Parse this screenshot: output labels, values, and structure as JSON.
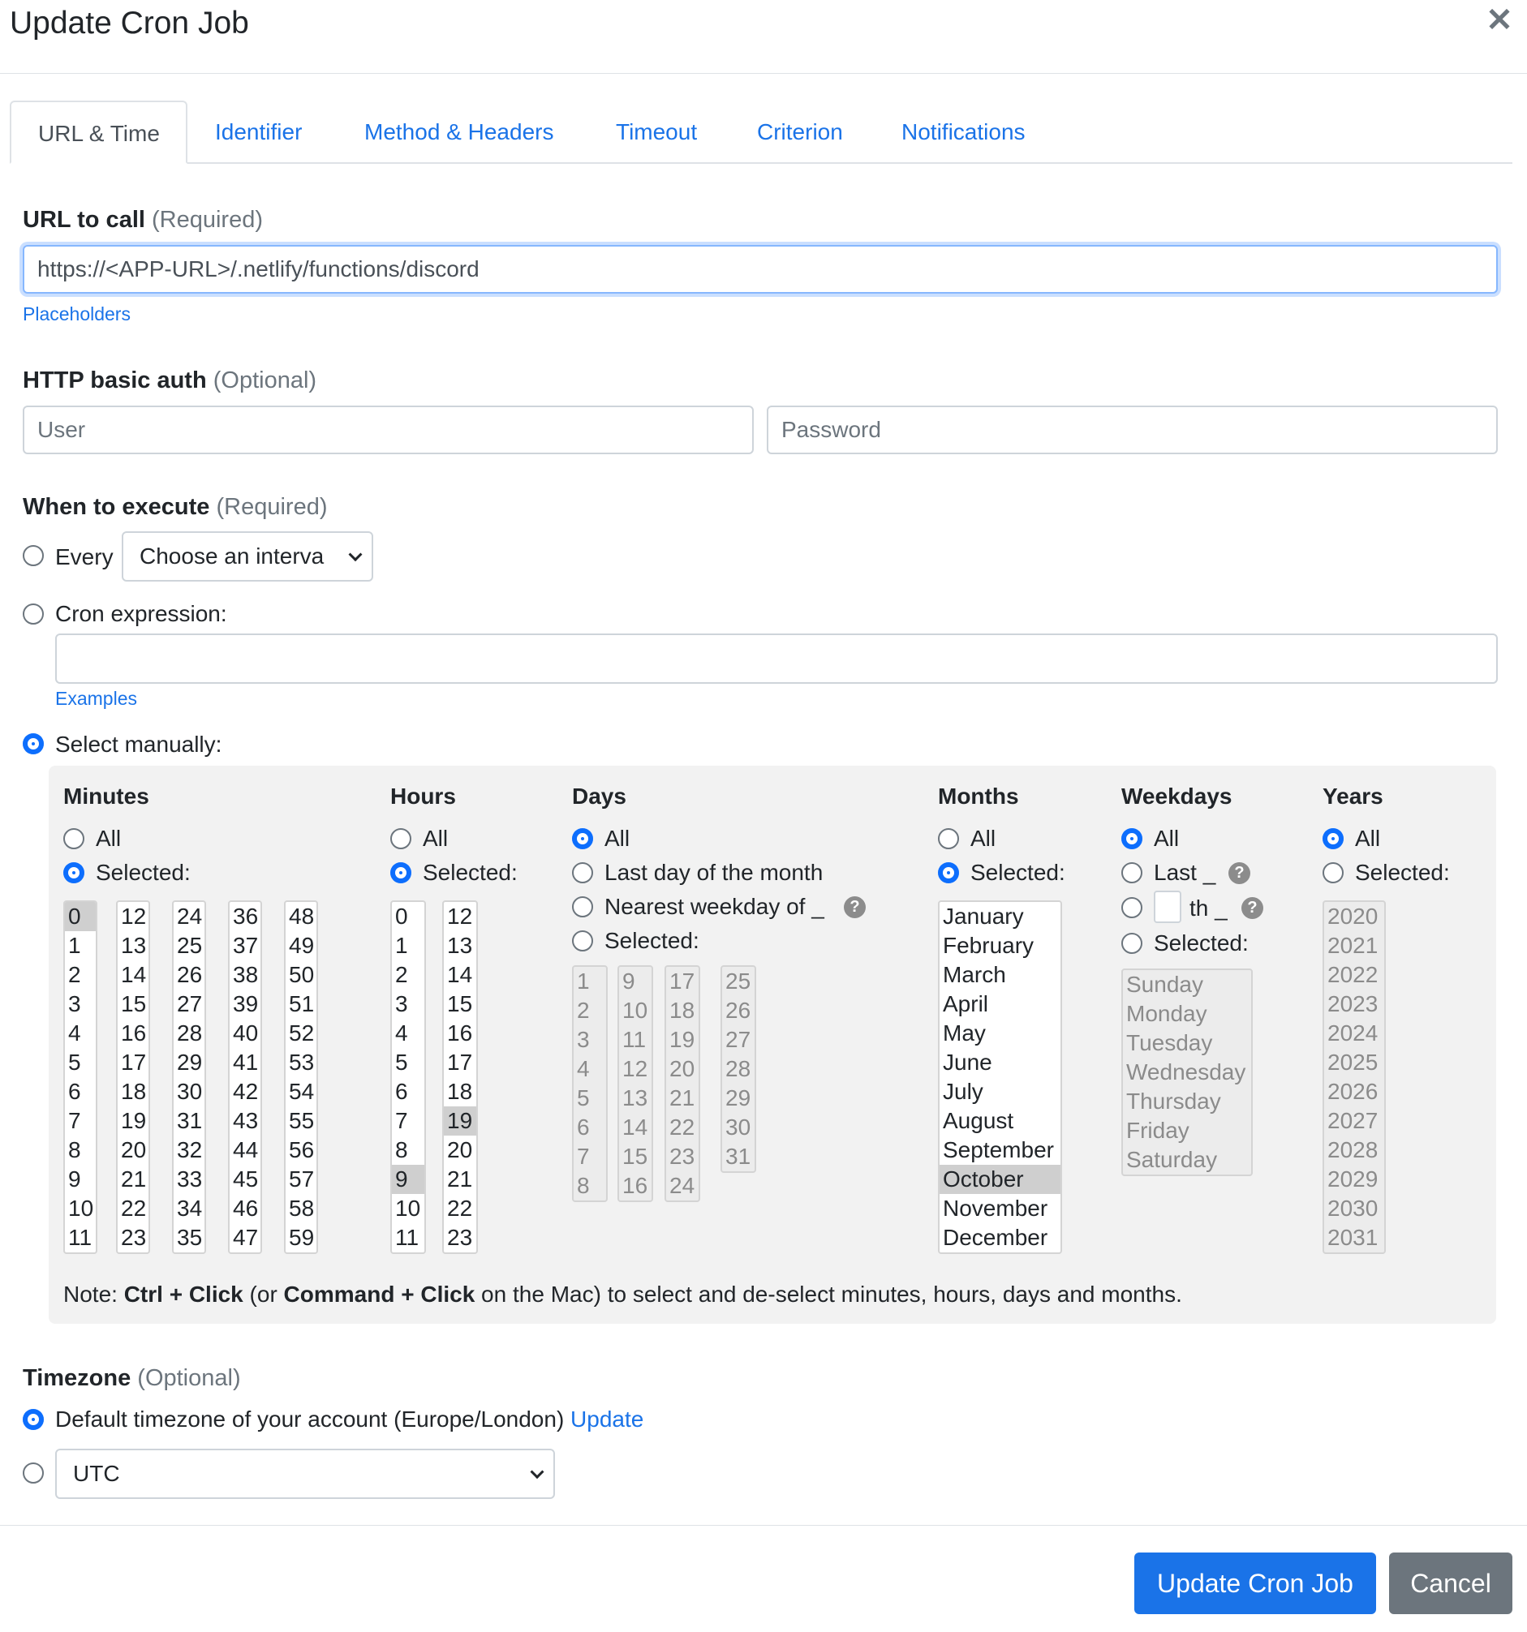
{
  "dialog": {
    "title": "Update Cron Job",
    "close_icon": "close-icon"
  },
  "tabs": [
    {
      "label": "URL & Time",
      "active": true
    },
    {
      "label": "Identifier"
    },
    {
      "label": "Method & Headers"
    },
    {
      "label": "Timeout"
    },
    {
      "label": "Criterion"
    },
    {
      "label": "Notifications"
    }
  ],
  "url": {
    "label": "URL to call",
    "hint": "(Required)",
    "value": "https://<APP-URL>/.netlify/functions/discord",
    "placeholders_link": "Placeholders"
  },
  "auth": {
    "label": "HTTP basic auth",
    "hint": "(Optional)",
    "user_placeholder": "User",
    "password_placeholder": "Password"
  },
  "when": {
    "label": "When to execute",
    "hint": "(Required)",
    "every_label": "Every",
    "interval_value": "Choose an interva",
    "cron_label": "Cron expression:",
    "examples_link": "Examples",
    "manual_label": "Select manually:",
    "selected_mode": "manual"
  },
  "schedule": {
    "minutes": {
      "title": "Minutes",
      "all": "All",
      "selected": "Selected:",
      "mode": "selected",
      "columns": [
        [
          "0",
          "1",
          "2",
          "3",
          "4",
          "5",
          "6",
          "7",
          "8",
          "9",
          "10",
          "11"
        ],
        [
          "12",
          "13",
          "14",
          "15",
          "16",
          "17",
          "18",
          "19",
          "20",
          "21",
          "22",
          "23"
        ],
        [
          "24",
          "25",
          "26",
          "27",
          "28",
          "29",
          "30",
          "31",
          "32",
          "33",
          "34",
          "35"
        ],
        [
          "36",
          "37",
          "38",
          "39",
          "40",
          "41",
          "42",
          "43",
          "44",
          "45",
          "46",
          "47"
        ],
        [
          "48",
          "49",
          "50",
          "51",
          "52",
          "53",
          "54",
          "55",
          "56",
          "57",
          "58",
          "59"
        ]
      ],
      "chosen": [
        "0"
      ]
    },
    "hours": {
      "title": "Hours",
      "all": "All",
      "selected": "Selected:",
      "mode": "selected",
      "columns": [
        [
          "0",
          "1",
          "2",
          "3",
          "4",
          "5",
          "6",
          "7",
          "8",
          "9",
          "10",
          "11"
        ],
        [
          "12",
          "13",
          "14",
          "15",
          "16",
          "17",
          "18",
          "19",
          "20",
          "21",
          "22",
          "23"
        ]
      ],
      "chosen": [
        "9",
        "19"
      ]
    },
    "days": {
      "title": "Days",
      "all": "All",
      "last_day": "Last day of the month",
      "nearest": "Nearest weekday of _",
      "selected": "Selected:",
      "mode": "all",
      "columns": [
        [
          "1",
          "2",
          "3",
          "4",
          "5",
          "6",
          "7",
          "8"
        ],
        [
          "9",
          "10",
          "11",
          "12",
          "13",
          "14",
          "15",
          "16"
        ],
        [
          "17",
          "18",
          "19",
          "20",
          "21",
          "22",
          "23",
          "24"
        ],
        [
          "25",
          "26",
          "27",
          "28",
          "29",
          "30",
          "31"
        ]
      ]
    },
    "months": {
      "title": "Months",
      "all": "All",
      "selected": "Selected:",
      "mode": "selected",
      "items": [
        "January",
        "February",
        "March",
        "April",
        "May",
        "June",
        "July",
        "August",
        "September",
        "October",
        "November",
        "December"
      ],
      "chosen": [
        "October"
      ]
    },
    "weekdays": {
      "title": "Weekdays",
      "all": "All",
      "last": "Last _",
      "nth": "th _",
      "selected": "Selected:",
      "mode": "all",
      "items": [
        "Sunday",
        "Monday",
        "Tuesday",
        "Wednesday",
        "Thursday",
        "Friday",
        "Saturday"
      ]
    },
    "years": {
      "title": "Years",
      "all": "All",
      "selected": "Selected:",
      "mode": "all",
      "items": [
        "2020",
        "2021",
        "2022",
        "2023",
        "2024",
        "2025",
        "2026",
        "2027",
        "2028",
        "2029",
        "2030",
        "2031"
      ]
    },
    "note": {
      "prefix": "Note: ",
      "ctrl": "Ctrl + Click",
      "mid1": " (or ",
      "cmd": "Command + Click",
      "suffix": " on the Mac) to select and de-select minutes, hours, days and months."
    }
  },
  "timezone": {
    "label": "Timezone",
    "hint": "(Optional)",
    "default_text": "Default timezone of your account (Europe/London)",
    "update_link": "Update",
    "custom_value": "UTC",
    "mode": "default"
  },
  "footer": {
    "update_button": "Update Cron Job",
    "cancel_button": "Cancel"
  },
  "colors": {
    "accent": "#1a73e8",
    "radio_checked": "#0d6efd",
    "secondary": "#6c757d",
    "panel": "#f2f2f2"
  }
}
